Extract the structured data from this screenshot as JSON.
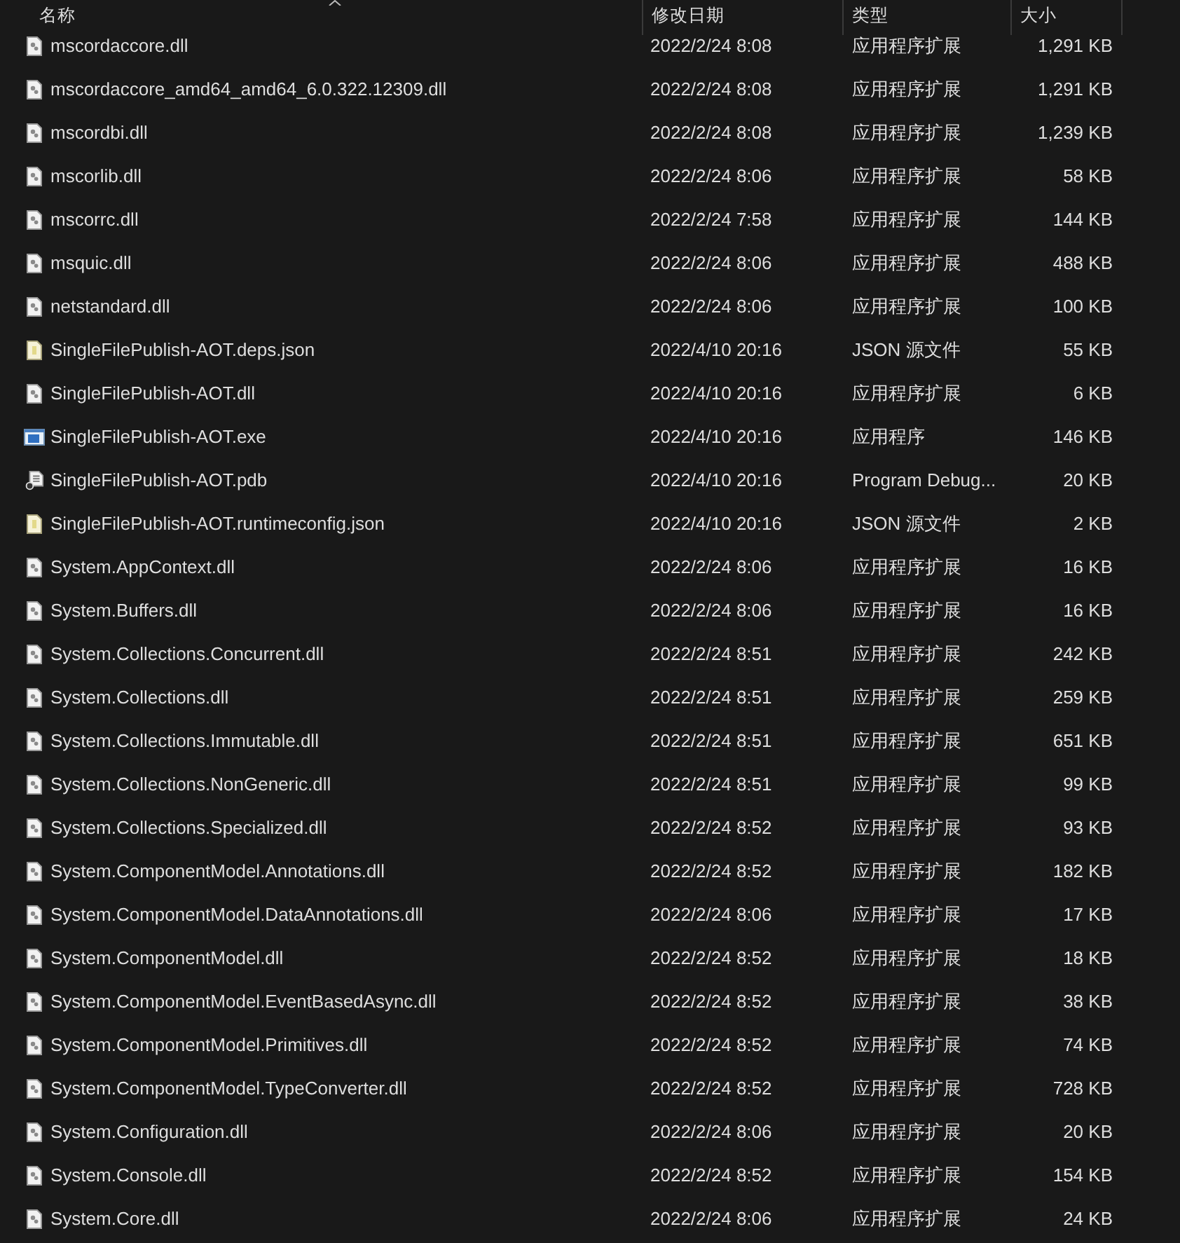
{
  "columns": [
    {
      "label": "名称",
      "sorted": true
    },
    {
      "label": "修改日期",
      "sorted": false
    },
    {
      "label": "类型",
      "sorted": false
    },
    {
      "label": "大小",
      "sorted": false
    }
  ],
  "rows": [
    {
      "kind": "dll",
      "name": "mscordaccore.dll",
      "date": "2022/2/24 8:08",
      "type": "应用程序扩展",
      "size": "1,291 KB"
    },
    {
      "kind": "dll",
      "name": "mscordaccore_amd64_amd64_6.0.322.12309.dll",
      "date": "2022/2/24 8:08",
      "type": "应用程序扩展",
      "size": "1,291 KB"
    },
    {
      "kind": "dll",
      "name": "mscordbi.dll",
      "date": "2022/2/24 8:08",
      "type": "应用程序扩展",
      "size": "1,239 KB"
    },
    {
      "kind": "dll",
      "name": "mscorlib.dll",
      "date": "2022/2/24 8:06",
      "type": "应用程序扩展",
      "size": "58 KB"
    },
    {
      "kind": "dll",
      "name": "mscorrc.dll",
      "date": "2022/2/24 7:58",
      "type": "应用程序扩展",
      "size": "144 KB"
    },
    {
      "kind": "dll",
      "name": "msquic.dll",
      "date": "2022/2/24 8:06",
      "type": "应用程序扩展",
      "size": "488 KB"
    },
    {
      "kind": "dll",
      "name": "netstandard.dll",
      "date": "2022/2/24 8:06",
      "type": "应用程序扩展",
      "size": "100 KB"
    },
    {
      "kind": "json",
      "name": "SingleFilePublish-AOT.deps.json",
      "date": "2022/4/10 20:16",
      "type": "JSON 源文件",
      "size": "55 KB"
    },
    {
      "kind": "dll",
      "name": "SingleFilePublish-AOT.dll",
      "date": "2022/4/10 20:16",
      "type": "应用程序扩展",
      "size": "6 KB"
    },
    {
      "kind": "exe",
      "name": "SingleFilePublish-AOT.exe",
      "date": "2022/4/10 20:16",
      "type": "应用程序",
      "size": "146 KB"
    },
    {
      "kind": "pdb",
      "name": "SingleFilePublish-AOT.pdb",
      "date": "2022/4/10 20:16",
      "type": "Program Debug...",
      "size": "20 KB"
    },
    {
      "kind": "json",
      "name": "SingleFilePublish-AOT.runtimeconfig.json",
      "date": "2022/4/10 20:16",
      "type": "JSON 源文件",
      "size": "2 KB"
    },
    {
      "kind": "dll",
      "name": "System.AppContext.dll",
      "date": "2022/2/24 8:06",
      "type": "应用程序扩展",
      "size": "16 KB"
    },
    {
      "kind": "dll",
      "name": "System.Buffers.dll",
      "date": "2022/2/24 8:06",
      "type": "应用程序扩展",
      "size": "16 KB"
    },
    {
      "kind": "dll",
      "name": "System.Collections.Concurrent.dll",
      "date": "2022/2/24 8:51",
      "type": "应用程序扩展",
      "size": "242 KB"
    },
    {
      "kind": "dll",
      "name": "System.Collections.dll",
      "date": "2022/2/24 8:51",
      "type": "应用程序扩展",
      "size": "259 KB"
    },
    {
      "kind": "dll",
      "name": "System.Collections.Immutable.dll",
      "date": "2022/2/24 8:51",
      "type": "应用程序扩展",
      "size": "651 KB"
    },
    {
      "kind": "dll",
      "name": "System.Collections.NonGeneric.dll",
      "date": "2022/2/24 8:51",
      "type": "应用程序扩展",
      "size": "99 KB"
    },
    {
      "kind": "dll",
      "name": "System.Collections.Specialized.dll",
      "date": "2022/2/24 8:52",
      "type": "应用程序扩展",
      "size": "93 KB"
    },
    {
      "kind": "dll",
      "name": "System.ComponentModel.Annotations.dll",
      "date": "2022/2/24 8:52",
      "type": "应用程序扩展",
      "size": "182 KB"
    },
    {
      "kind": "dll",
      "name": "System.ComponentModel.DataAnnotations.dll",
      "date": "2022/2/24 8:06",
      "type": "应用程序扩展",
      "size": "17 KB"
    },
    {
      "kind": "dll",
      "name": "System.ComponentModel.dll",
      "date": "2022/2/24 8:52",
      "type": "应用程序扩展",
      "size": "18 KB"
    },
    {
      "kind": "dll",
      "name": "System.ComponentModel.EventBasedAsync.dll",
      "date": "2022/2/24 8:52",
      "type": "应用程序扩展",
      "size": "38 KB"
    },
    {
      "kind": "dll",
      "name": "System.ComponentModel.Primitives.dll",
      "date": "2022/2/24 8:52",
      "type": "应用程序扩展",
      "size": "74 KB"
    },
    {
      "kind": "dll",
      "name": "System.ComponentModel.TypeConverter.dll",
      "date": "2022/2/24 8:52",
      "type": "应用程序扩展",
      "size": "728 KB"
    },
    {
      "kind": "dll",
      "name": "System.Configuration.dll",
      "date": "2022/2/24 8:06",
      "type": "应用程序扩展",
      "size": "20 KB"
    },
    {
      "kind": "dll",
      "name": "System.Console.dll",
      "date": "2022/2/24 8:52",
      "type": "应用程序扩展",
      "size": "154 KB"
    },
    {
      "kind": "dll",
      "name": "System.Core.dll",
      "date": "2022/2/24 8:06",
      "type": "应用程序扩展",
      "size": "24 KB"
    }
  ]
}
